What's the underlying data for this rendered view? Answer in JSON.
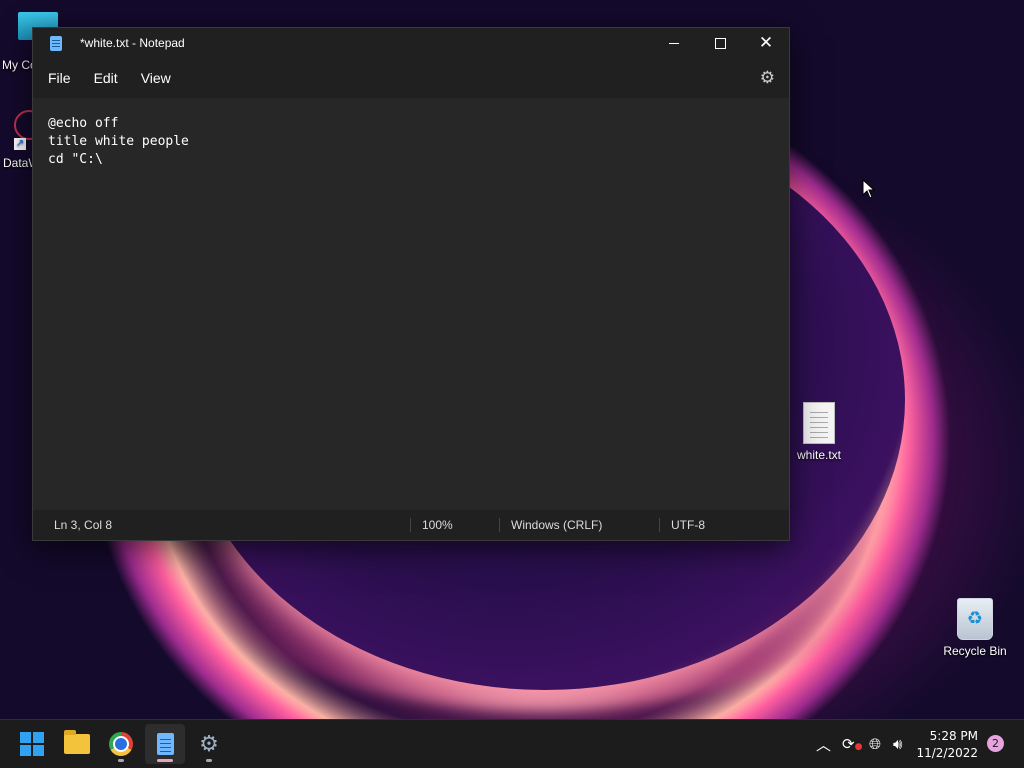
{
  "desktop": {
    "icons": {
      "my_computer": "My Co",
      "dataw": "DataW",
      "white_txt": "white.txt",
      "recycle_bin": "Recycle Bin"
    }
  },
  "window": {
    "title": "*white.txt - Notepad",
    "menu": [
      "File",
      "Edit",
      "View"
    ],
    "editor_text": "@echo off\ntitle white people\ncd \"C:\\",
    "status": {
      "position": "Ln 3, Col 8",
      "zoom": "100%",
      "line_ending": "Windows (CRLF)",
      "encoding": "UTF-8"
    }
  },
  "taskbar": {
    "clock_time": "5:28 PM",
    "clock_date": "11/2/2022",
    "notification_count": "2"
  },
  "colors": {
    "accent": "#2fa3f2",
    "window_bg": "#202020",
    "editor_bg": "#272727"
  }
}
